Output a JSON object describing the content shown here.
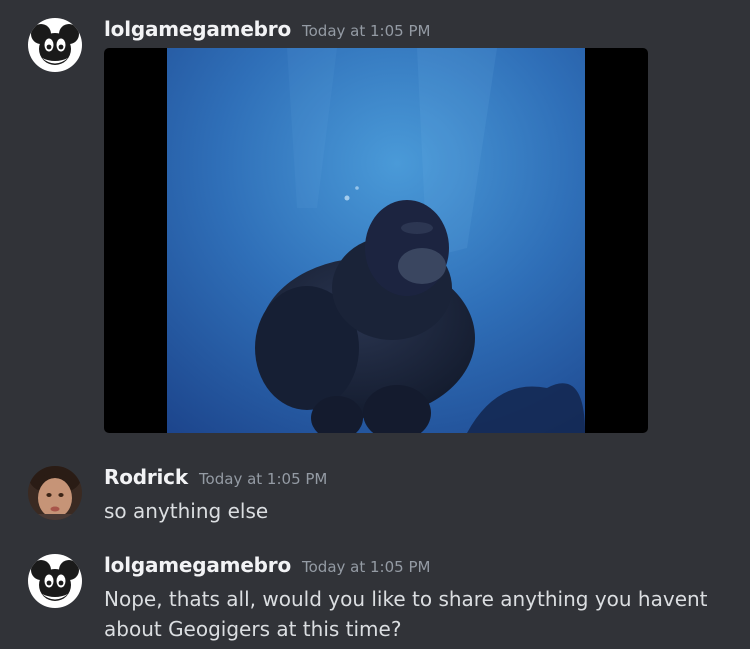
{
  "messages": [
    {
      "author": "lolgamegamebro",
      "timestamp": "Today at 1:05 PM",
      "text": "",
      "attachment": "video"
    },
    {
      "author": "Rodrick",
      "timestamp": "Today at 1:05 PM",
      "text": "so anything else"
    },
    {
      "author": "lolgamegamebro",
      "timestamp": "Today at 1:05 PM",
      "text": "Nope, thats all, would you like to share anything you havent about Geogigers at this time?"
    }
  ],
  "colors": {
    "background": "#313338",
    "username": "#f2f3f5",
    "timestamp": "#949ba4",
    "message_text": "#dbdee1"
  }
}
